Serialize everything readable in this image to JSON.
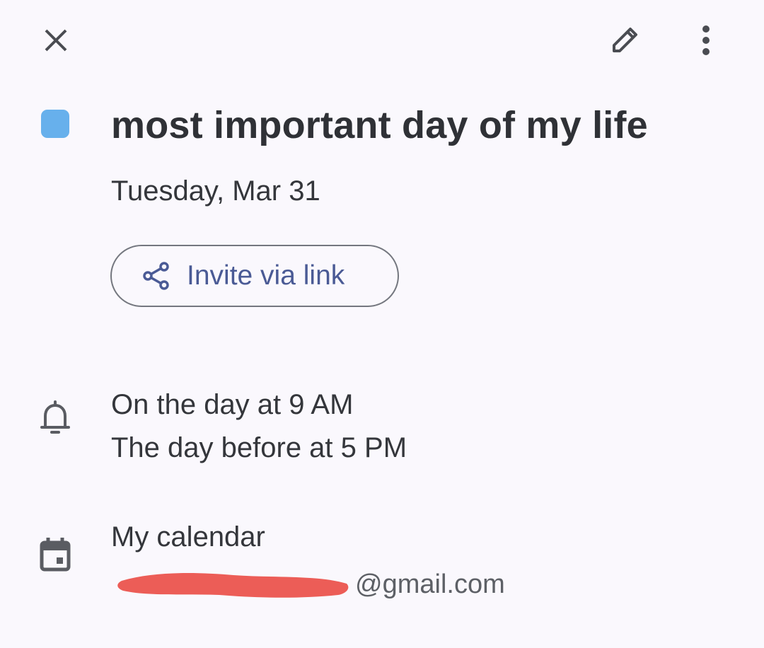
{
  "header": {
    "close_icon": "close-icon",
    "edit_icon": "pencil-icon",
    "more_icon": "more-vert-icon"
  },
  "event": {
    "title": "most important day of my life",
    "date": "Tuesday, Mar 31",
    "color": "#67b0ec"
  },
  "invite": {
    "label": "Invite via link",
    "icon": "share-icon",
    "color": "#4a5a95"
  },
  "reminders": {
    "icon": "bell-icon",
    "items": [
      "On the day at 9 AM",
      "The day before at 5 PM"
    ]
  },
  "calendar": {
    "icon": "calendar-icon",
    "name": "My calendar",
    "email_visible_suffix": "@gmail.com",
    "redaction_color": "#ec5d57"
  }
}
